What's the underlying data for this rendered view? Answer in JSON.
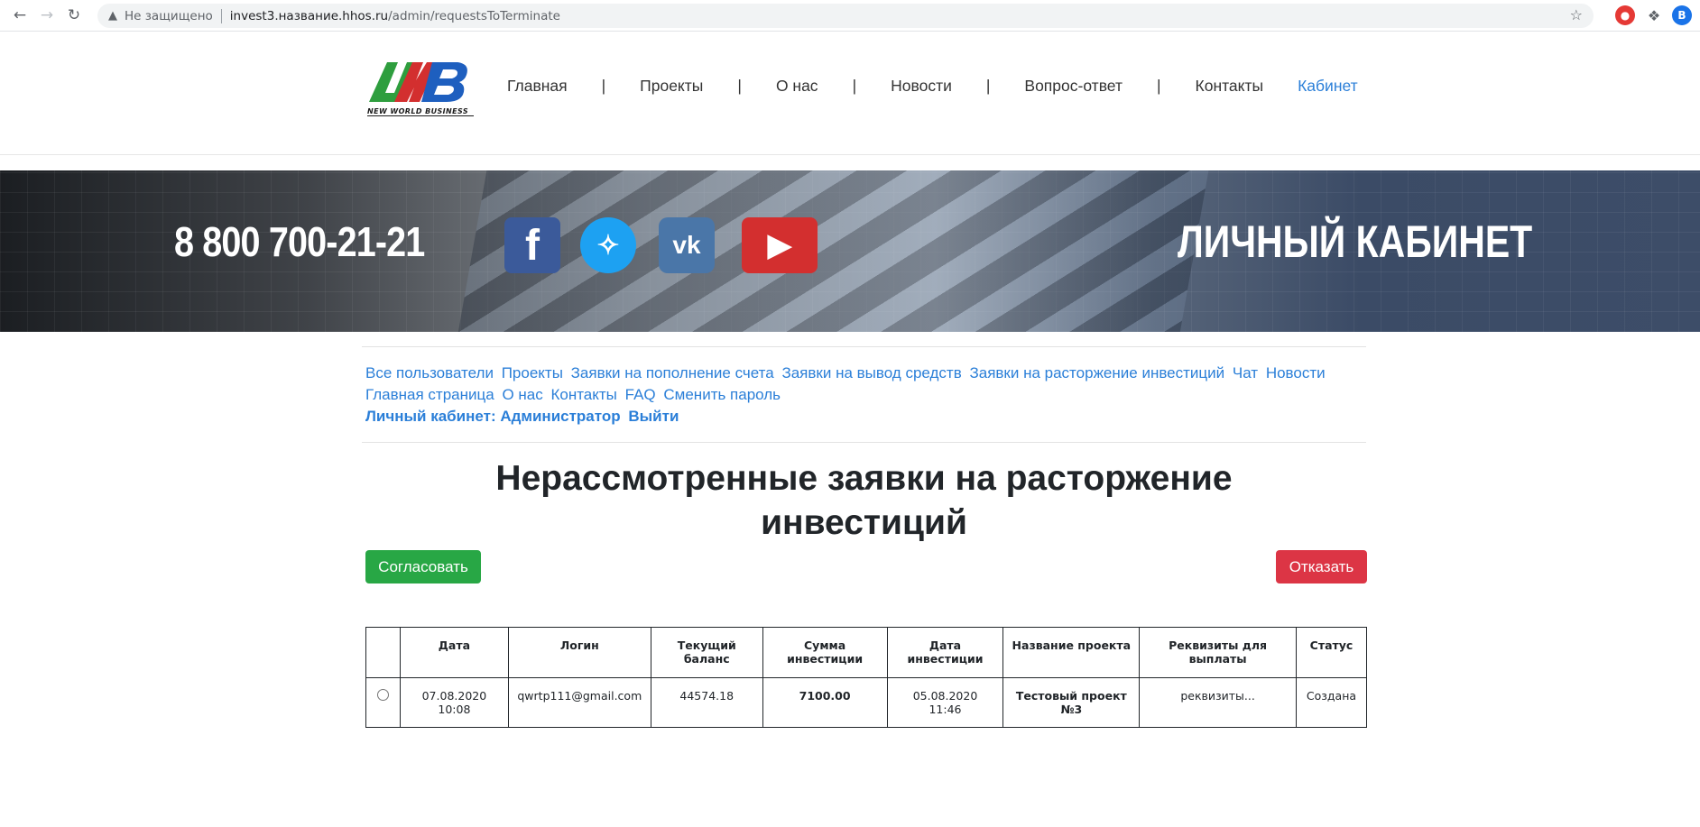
{
  "browser": {
    "insecure_label": "Не защищено",
    "url_host": "invest3.название.hhos.ru",
    "url_path": "/admin/requestsToTerminate",
    "avatar_letter": "B"
  },
  "logo": {
    "text": "NWB",
    "subtitle": "NEW WORLD BUSINESS"
  },
  "nav": {
    "items": [
      {
        "label": "Главная"
      },
      {
        "label": "Проекты"
      },
      {
        "label": "О нас"
      },
      {
        "label": "Новости"
      },
      {
        "label": "Вопрос-ответ"
      },
      {
        "label": "Контакты"
      },
      {
        "label": "Кабинет"
      }
    ],
    "separator": "|"
  },
  "banner": {
    "phone": "8 800 700-21-21",
    "title": "ЛИЧНЫЙ КАБИНЕТ",
    "social": [
      "facebook-icon",
      "twitter-icon",
      "vk-icon",
      "youtube-icon"
    ]
  },
  "admin_menu": {
    "links": [
      "Все пользователи",
      "Проекты",
      "Заявки на пополнение счета",
      "Заявки на вывод средств",
      "Заявки на расторжение инвестиций",
      "Чат",
      "Новости",
      "Главная страница",
      "О нас",
      "Контакты",
      "FAQ",
      "Сменить пароль"
    ],
    "cabinet": "Личный кабинет: Администратор",
    "logout": "Выйти"
  },
  "page": {
    "title_line1": "Нерассмотренные заявки на расторжение",
    "title_line2": "инвестиций",
    "approve_label": "Согласовать",
    "reject_label": "Отказать"
  },
  "table": {
    "headers": [
      "",
      "Дата",
      "Логин",
      "Текущий баланс",
      "Сумма инвестиции",
      "Дата инвестиции",
      "Название проекта",
      "Реквизиты для выплаты",
      "Статус"
    ],
    "rows": [
      {
        "date_day": "07.08.2020",
        "date_time": "10:08",
        "login": "qwrtp111@gmail.com",
        "balance": "44574.18",
        "sum": "7100.00",
        "inv_date_day": "05.08.2020",
        "inv_date_time": "11:46",
        "project": "Тестовый проект №3",
        "requisites": "реквизиты...",
        "status": "Создана"
      }
    ]
  },
  "colors": {
    "link": "#2b7fd8",
    "approve": "#28a745",
    "reject": "#dc3545"
  }
}
